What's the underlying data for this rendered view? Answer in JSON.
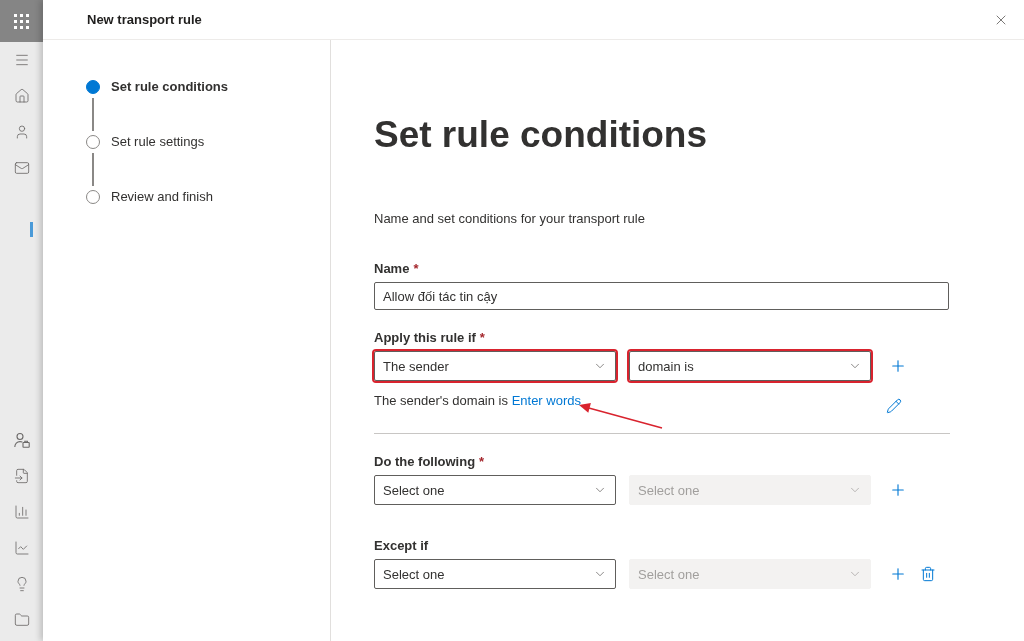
{
  "panel": {
    "title": "New transport rule"
  },
  "steps": [
    {
      "label": "Set rule conditions",
      "selected": true
    },
    {
      "label": "Set rule settings",
      "selected": false
    },
    {
      "label": "Review and finish",
      "selected": false
    }
  ],
  "heading": "Set rule conditions",
  "description": "Name and set conditions for your transport rule",
  "name_field": {
    "label": "Name",
    "required_mark": "*",
    "value": "Allow đối tác tin cậy"
  },
  "sections": [
    {
      "label": "Apply this rule if",
      "required_mark": "*",
      "dropdowns": [
        {
          "value": "The sender",
          "disabled": false,
          "highlighted": true
        },
        {
          "value": "domain is",
          "disabled": false,
          "highlighted": true
        }
      ],
      "deletable": false,
      "summary": {
        "text": "The sender's domain is",
        "link": "Enter words",
        "arrow": true
      }
    },
    {
      "label": "Do the following",
      "required_mark": "*",
      "dropdowns": [
        {
          "placeholder": "Select one",
          "disabled": false,
          "highlighted": false
        },
        {
          "placeholder": "Select one",
          "disabled": true,
          "highlighted": false
        }
      ],
      "deletable": false
    },
    {
      "label": "Except if",
      "dropdowns": [
        {
          "placeholder": "Select one",
          "disabled": false,
          "highlighted": false
        },
        {
          "placeholder": "Select one",
          "disabled": true,
          "highlighted": false
        }
      ],
      "deletable": true
    }
  ]
}
